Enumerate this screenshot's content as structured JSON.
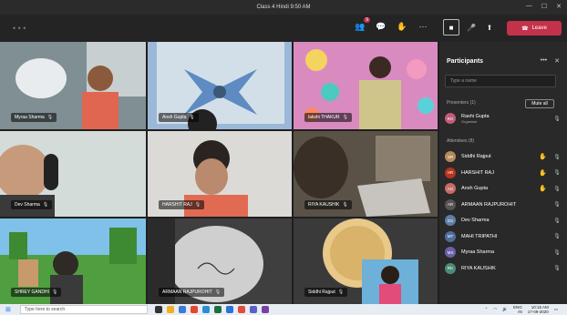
{
  "window": {
    "title": "Class 4 Hindi 9:50 AM"
  },
  "toolbar": {
    "menu_dots": "• • •",
    "chat_badge": "9",
    "leave_label": "Leave"
  },
  "tiles": [
    {
      "id": "myraa",
      "name": "Myraa Sharma",
      "bg": "#6a7d86"
    },
    {
      "id": "ansh",
      "name": "Ansh Gupta",
      "bg": "#9bb6d6"
    },
    {
      "id": "lakshmi",
      "name": "lakshi THAKUR",
      "bg": "#d678b0"
    },
    {
      "id": "dev",
      "name": "Dev Sharma",
      "bg": "#cfd6d3"
    },
    {
      "id": "harshit",
      "name": "HARSHIT RAJ",
      "bg": "#d9d6d0"
    },
    {
      "id": "riya",
      "name": "RIYA KAUSHIK",
      "bg": "#5b5448"
    },
    {
      "id": "shrey",
      "name": "SHREY GANDHI",
      "bg": "#5aa24a"
    },
    {
      "id": "armaan",
      "name": "ARMAAN RAJPUROHIT",
      "bg": "#4a4a4a"
    },
    {
      "id": "siddhi",
      "name": "Siddhi Rajput",
      "bg": "#3c3c3c"
    }
  ],
  "panel": {
    "title": "Participants",
    "search_placeholder": "Type a name",
    "presenters_label": "Presenters (1)",
    "attendees_label": "Attendees (8)",
    "mute_all": "Mute all",
    "presenters": [
      {
        "initials": "RG",
        "name": "Rashi Gupta",
        "role": "Organiser",
        "color": "#c45b7a"
      }
    ],
    "attendees": [
      {
        "initials": "SR",
        "name": "Siddhi Rajput",
        "color": "#b58b5e",
        "hand": true
      },
      {
        "initials": "HR",
        "name": "HARSHIT RAJ",
        "color": "#b8331f",
        "hand": true
      },
      {
        "initials": "AG",
        "name": "Ansh Gupta",
        "color": "#c86a6a",
        "hand": true
      },
      {
        "initials": "AR",
        "name": "ARMAAN RAJPUROHIT",
        "color": "#555555",
        "hand": false
      },
      {
        "initials": "DS",
        "name": "Dev Sharma",
        "color": "#5e7fa3",
        "hand": false
      },
      {
        "initials": "MT",
        "name": "MAHI TRIPATHI",
        "color": "#4d6e9c",
        "hand": false
      },
      {
        "initials": "MS",
        "name": "Myraa Sharma",
        "color": "#6c5fa8",
        "hand": false
      },
      {
        "initials": "RK",
        "name": "RIYA KAUSHIK",
        "color": "#4a8c7a",
        "hand": false
      }
    ]
  },
  "taskbar": {
    "search_placeholder": "Type here to search",
    "lang": "ENG",
    "region": "IN",
    "time": "10:15 AM",
    "date": "17-09-2020"
  }
}
